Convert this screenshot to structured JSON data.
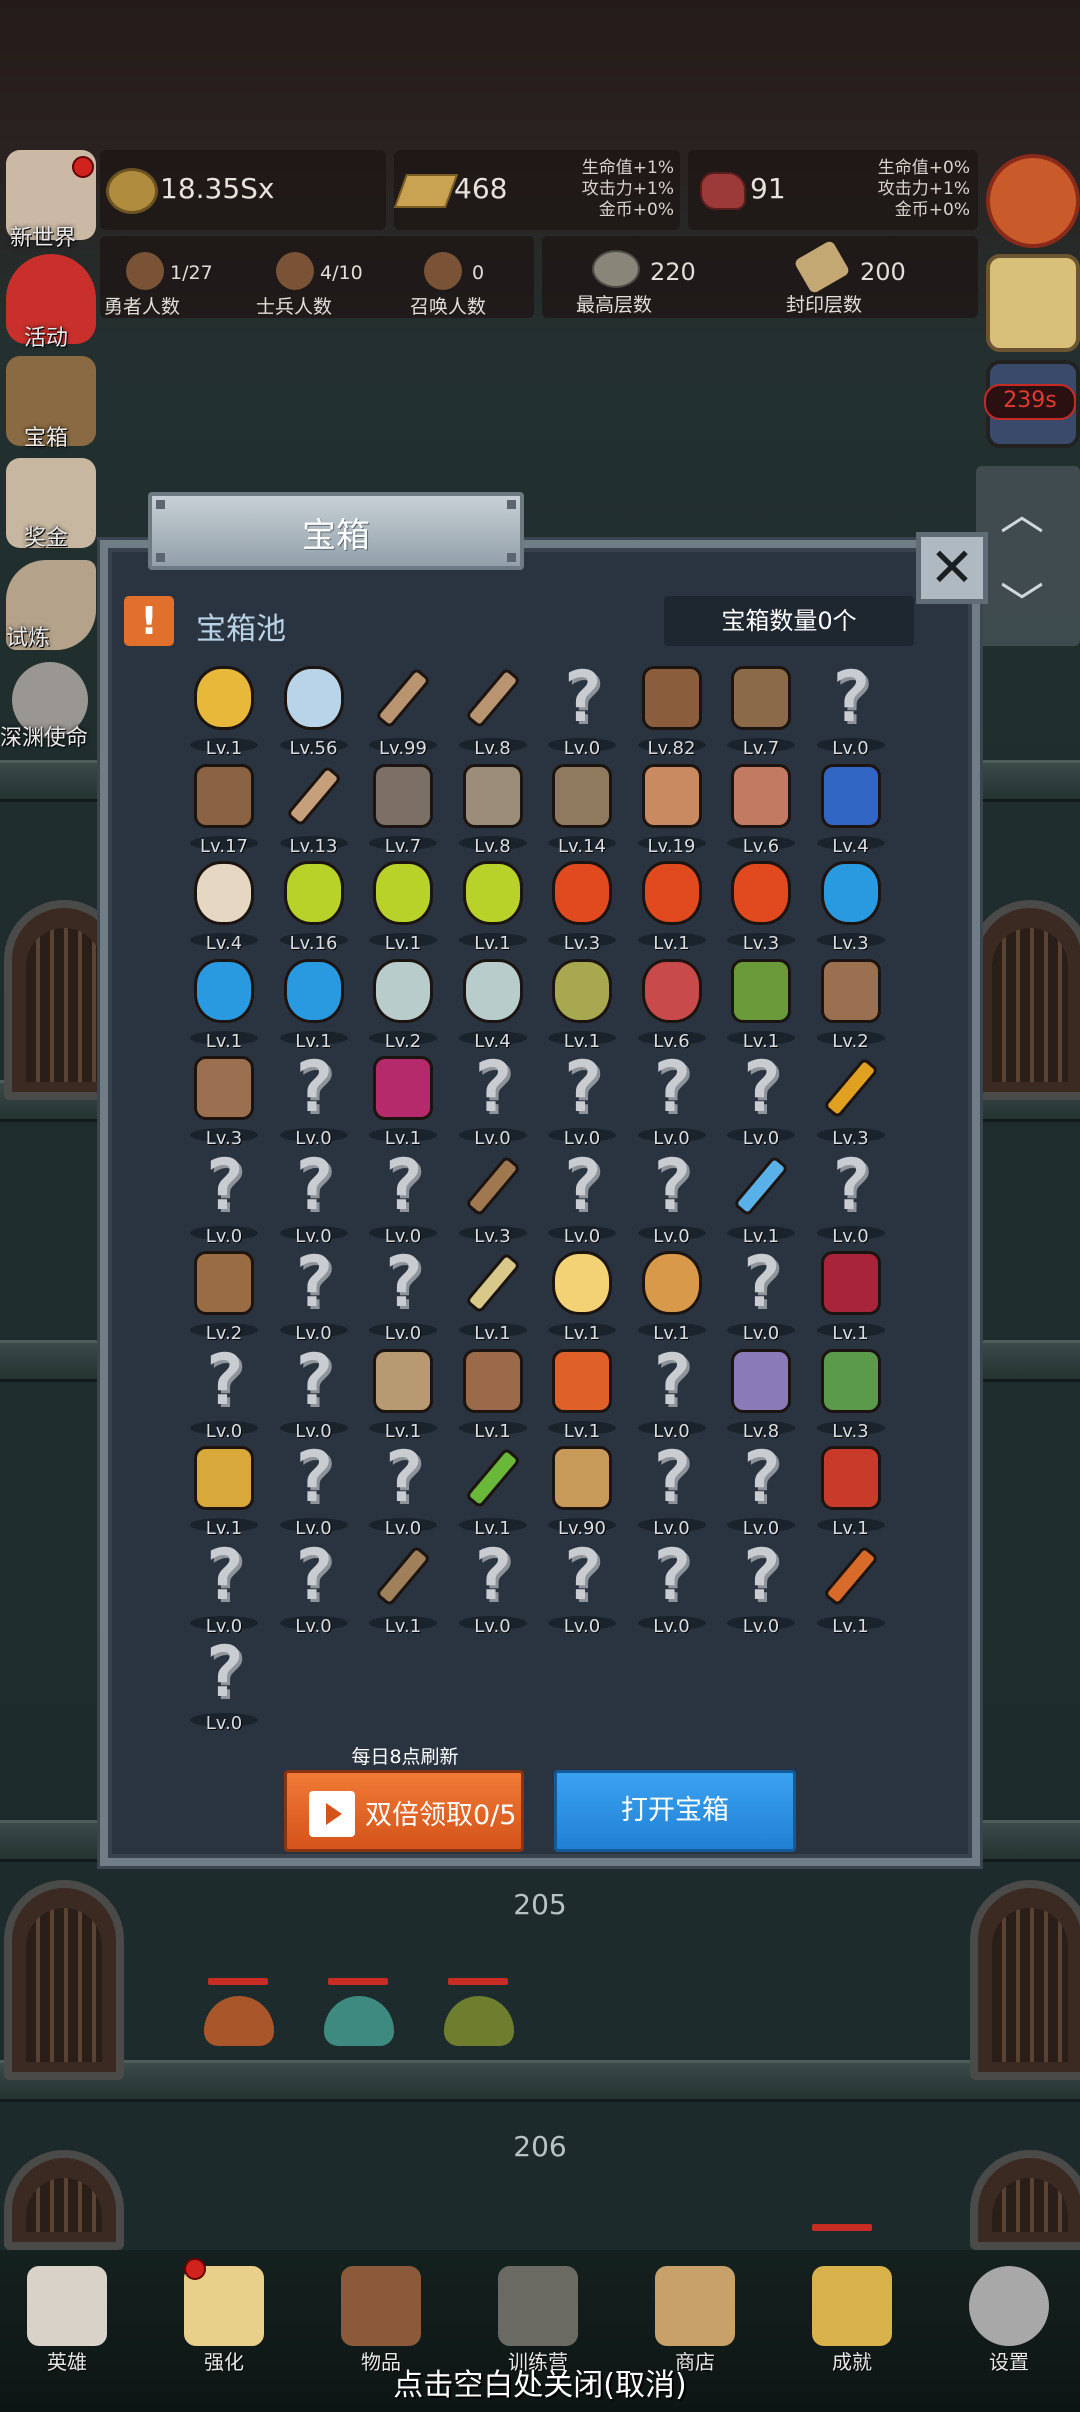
{
  "resources": {
    "gold": "18.35Sx",
    "gold_bar": "468",
    "gold_bar_bonus": [
      "生命值+1%",
      "攻击力+1%",
      "金币+0%"
    ],
    "meat": "91",
    "meat_bonus": [
      "生命值+0%",
      "攻击力+1%",
      "金币+0%"
    ]
  },
  "stats": [
    {
      "value": "1/27",
      "label": "勇者人数"
    },
    {
      "value": "4/10",
      "label": "士兵人数"
    },
    {
      "value": "0",
      "label": "召唤人数"
    }
  ],
  "floors": [
    {
      "value": "220",
      "label": "最高层数"
    },
    {
      "value": "200",
      "label": "封印层数"
    }
  ],
  "left_menu": [
    "新世界",
    "活动",
    "宝箱",
    "奖金",
    "试炼",
    "深渊使命"
  ],
  "right_menu": {
    "timer": "239s"
  },
  "modal": {
    "title": "宝箱",
    "close": "✕",
    "pool_icon": "!",
    "pool_title": "宝箱池",
    "chest_count": "宝箱数量0个",
    "refresh_note": "每日8点刷新",
    "double_claim": "双倍领取0/5",
    "open_chest": "打开宝箱"
  },
  "items": [
    {
      "icon": "crown-icon",
      "lv": "Lv.1"
    },
    {
      "icon": "diamond-icon",
      "lv": "Lv.56"
    },
    {
      "icon": "sword-icon",
      "lv": "Lv.99"
    },
    {
      "icon": "sword-icon",
      "lv": "Lv.8"
    },
    {
      "icon": "unknown-icon",
      "lv": "Lv.0"
    },
    {
      "icon": "leather-armor-icon",
      "lv": "Lv.82"
    },
    {
      "icon": "backpack-icon",
      "lv": "Lv.7"
    },
    {
      "icon": "unknown-icon",
      "lv": "Lv.0"
    },
    {
      "icon": "leather-helmet-icon",
      "lv": "Lv.17"
    },
    {
      "icon": "dagger-icon",
      "lv": "Lv.13"
    },
    {
      "icon": "knight-helmet-icon",
      "lv": "Lv.7"
    },
    {
      "icon": "hammer-icon",
      "lv": "Lv.8"
    },
    {
      "icon": "great-helm-icon",
      "lv": "Lv.14"
    },
    {
      "icon": "ham-icon",
      "lv": "Lv.19"
    },
    {
      "icon": "steak-icon",
      "lv": "Lv.6"
    },
    {
      "icon": "blue-pouch-icon",
      "lv": "Lv.4"
    },
    {
      "icon": "bread-icon",
      "lv": "Lv.4"
    },
    {
      "icon": "yellow-potion-icon",
      "lv": "Lv.16"
    },
    {
      "icon": "yellow-potion-icon",
      "lv": "Lv.1"
    },
    {
      "icon": "yellow-potion-icon",
      "lv": "Lv.1"
    },
    {
      "icon": "red-potion-icon",
      "lv": "Lv.3"
    },
    {
      "icon": "red-potion-icon",
      "lv": "Lv.1"
    },
    {
      "icon": "red-potion-icon",
      "lv": "Lv.3"
    },
    {
      "icon": "blue-potion-icon",
      "lv": "Lv.3"
    },
    {
      "icon": "blue-potion-icon",
      "lv": "Lv.1"
    },
    {
      "icon": "blue-potion-icon",
      "lv": "Lv.1"
    },
    {
      "icon": "empty-potion-icon",
      "lv": "Lv.2"
    },
    {
      "icon": "empty-potion-icon",
      "lv": "Lv.4"
    },
    {
      "icon": "wine-bottle-icon",
      "lv": "Lv.1"
    },
    {
      "icon": "red-bottle-icon",
      "lv": "Lv.6"
    },
    {
      "icon": "winged-boot-icon",
      "lv": "Lv.1"
    },
    {
      "icon": "boot-icon",
      "lv": "Lv.2"
    },
    {
      "icon": "boot-icon",
      "lv": "Lv.3"
    },
    {
      "icon": "unknown-icon",
      "lv": "Lv.0"
    },
    {
      "icon": "magic-boots-icon",
      "lv": "Lv.1"
    },
    {
      "icon": "unknown-icon",
      "lv": "Lv.0"
    },
    {
      "icon": "unknown-icon",
      "lv": "Lv.0"
    },
    {
      "icon": "unknown-icon",
      "lv": "Lv.0"
    },
    {
      "icon": "unknown-icon",
      "lv": "Lv.0"
    },
    {
      "icon": "torch-icon",
      "lv": "Lv.3"
    },
    {
      "icon": "unknown-icon",
      "lv": "Lv.0"
    },
    {
      "icon": "unknown-icon",
      "lv": "Lv.0"
    },
    {
      "icon": "unknown-icon",
      "lv": "Lv.0"
    },
    {
      "icon": "wooden-staff-icon",
      "lv": "Lv.3"
    },
    {
      "icon": "unknown-icon",
      "lv": "Lv.0"
    },
    {
      "icon": "unknown-icon",
      "lv": "Lv.0"
    },
    {
      "icon": "blue-wand-icon",
      "lv": "Lv.1"
    },
    {
      "icon": "unknown-icon",
      "lv": "Lv.0"
    },
    {
      "icon": "leather-bag-icon",
      "lv": "Lv.2"
    },
    {
      "icon": "unknown-icon",
      "lv": "Lv.0"
    },
    {
      "icon": "unknown-icon",
      "lv": "Lv.0"
    },
    {
      "icon": "bone-club-icon",
      "lv": "Lv.1"
    },
    {
      "icon": "cheese-icon",
      "lv": "Lv.1"
    },
    {
      "icon": "pie-icon",
      "lv": "Lv.1"
    },
    {
      "icon": "unknown-icon",
      "lv": "Lv.0"
    },
    {
      "icon": "red-crystal-icon",
      "lv": "Lv.1"
    },
    {
      "icon": "unknown-icon",
      "lv": "Lv.0"
    },
    {
      "icon": "unknown-icon",
      "lv": "Lv.0"
    },
    {
      "icon": "bow-icon",
      "lv": "Lv.1"
    },
    {
      "icon": "quiver-icon",
      "lv": "Lv.1"
    },
    {
      "icon": "fire-amulet-icon",
      "lv": "Lv.1"
    },
    {
      "icon": "unknown-icon",
      "lv": "Lv.0"
    },
    {
      "icon": "tentacle-icon",
      "lv": "Lv.8"
    },
    {
      "icon": "rune-shield-icon",
      "lv": "Lv.3"
    },
    {
      "icon": "scroll-icon",
      "lv": "Lv.1"
    },
    {
      "icon": "unknown-icon",
      "lv": "Lv.0"
    },
    {
      "icon": "unknown-icon",
      "lv": "Lv.0"
    },
    {
      "icon": "green-wand-icon",
      "lv": "Lv.1"
    },
    {
      "icon": "beer-mug-icon",
      "lv": "Lv.90"
    },
    {
      "icon": "unknown-icon",
      "lv": "Lv.0"
    },
    {
      "icon": "unknown-icon",
      "lv": "Lv.0"
    },
    {
      "icon": "red-book-icon",
      "lv": "Lv.1"
    },
    {
      "icon": "unknown-icon",
      "lv": "Lv.0"
    },
    {
      "icon": "unknown-icon",
      "lv": "Lv.0"
    },
    {
      "icon": "whip-icon",
      "lv": "Lv.1"
    },
    {
      "icon": "unknown-icon",
      "lv": "Lv.0"
    },
    {
      "icon": "unknown-icon",
      "lv": "Lv.0"
    },
    {
      "icon": "unknown-icon",
      "lv": "Lv.0"
    },
    {
      "icon": "unknown-icon",
      "lv": "Lv.0"
    },
    {
      "icon": "fire-arrow-icon",
      "lv": "Lv.1"
    },
    {
      "icon": "unknown-icon",
      "lv": "Lv.0"
    }
  ],
  "background": {
    "floor_upper": "205",
    "floor_lower": "206"
  },
  "bottom_nav": [
    "英雄",
    "强化",
    "物品",
    "训练营",
    "商店",
    "成就",
    "设置"
  ],
  "close_hint": "点击空白处关闭(取消)",
  "colors": {
    "modal_bg": "#2a3440",
    "double_btn": "#e0692a",
    "open_btn": "#2a8de0",
    "accent_orange": "#e0702c"
  }
}
